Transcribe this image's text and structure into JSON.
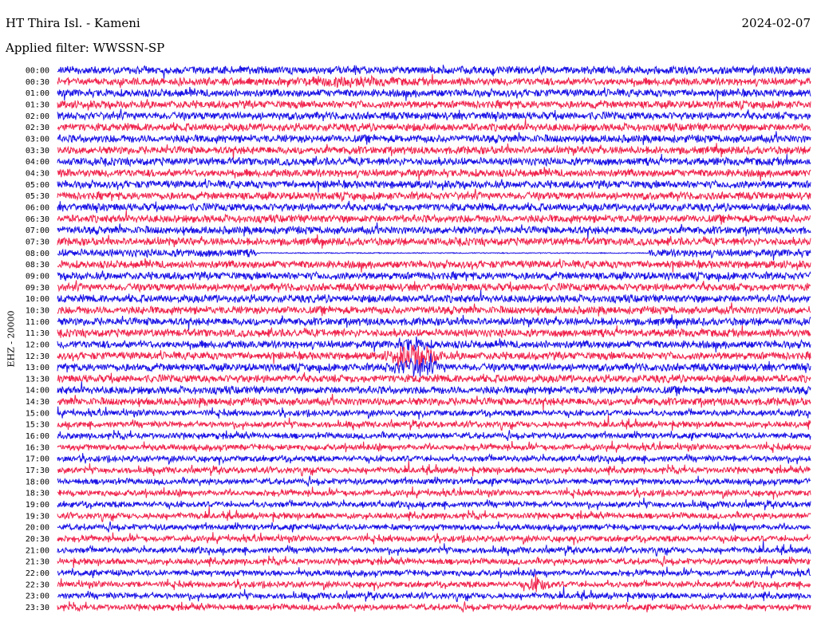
{
  "header": {
    "station": "HT Thira Isl. - Kameni",
    "date": "2024-02-07",
    "filter": "Applied filter: WWSSN-SP"
  },
  "channel": "EHZ - 20000",
  "colors": {
    "trace_a": "#1a12e6",
    "trace_b": "#f0244d",
    "text": "#000000",
    "background": "#ffffff"
  },
  "chart_data": {
    "type": "line",
    "ylabel": "EHZ - 20000",
    "row_labels": [
      "00:00",
      "00:30",
      "01:00",
      "01:30",
      "02:00",
      "02:30",
      "03:00",
      "03:30",
      "04:00",
      "04:30",
      "05:00",
      "05:30",
      "06:00",
      "06:30",
      "07:00",
      "07:30",
      "08:00",
      "08:30",
      "09:00",
      "09:30",
      "10:00",
      "10:30",
      "11:00",
      "11:30",
      "12:00",
      "12:30",
      "13:00",
      "13:30",
      "14:00",
      "14:30",
      "15:00",
      "15:30",
      "16:00",
      "16:30",
      "17:00",
      "17:30",
      "18:00",
      "18:30",
      "19:00",
      "19:30",
      "20:00",
      "20:30",
      "21:00",
      "21:30",
      "22:00",
      "22:30",
      "23:00",
      "23:30"
    ],
    "row_span_minutes": 30,
    "series": [
      {
        "color": "#1a12e6",
        "rows": "even"
      },
      {
        "color": "#f0244d",
        "rows": "odd"
      }
    ],
    "events": [
      {
        "row": "00:30",
        "start": 0.295,
        "end": 0.47,
        "amplitude": 1.6
      },
      {
        "row": "08:00",
        "start": 0.265,
        "end": 0.785,
        "amplitude": 0.0
      },
      {
        "row": "12:00",
        "start": 0.44,
        "end": 0.5,
        "amplitude": 2.2
      },
      {
        "row": "12:30",
        "start": 0.43,
        "end": 0.52,
        "amplitude": 3.5
      },
      {
        "row": "13:00",
        "start": 0.43,
        "end": 0.52,
        "amplitude": 2.8
      },
      {
        "row": "22:30",
        "start": 0.615,
        "end": 0.66,
        "amplitude": 3.0
      }
    ]
  }
}
